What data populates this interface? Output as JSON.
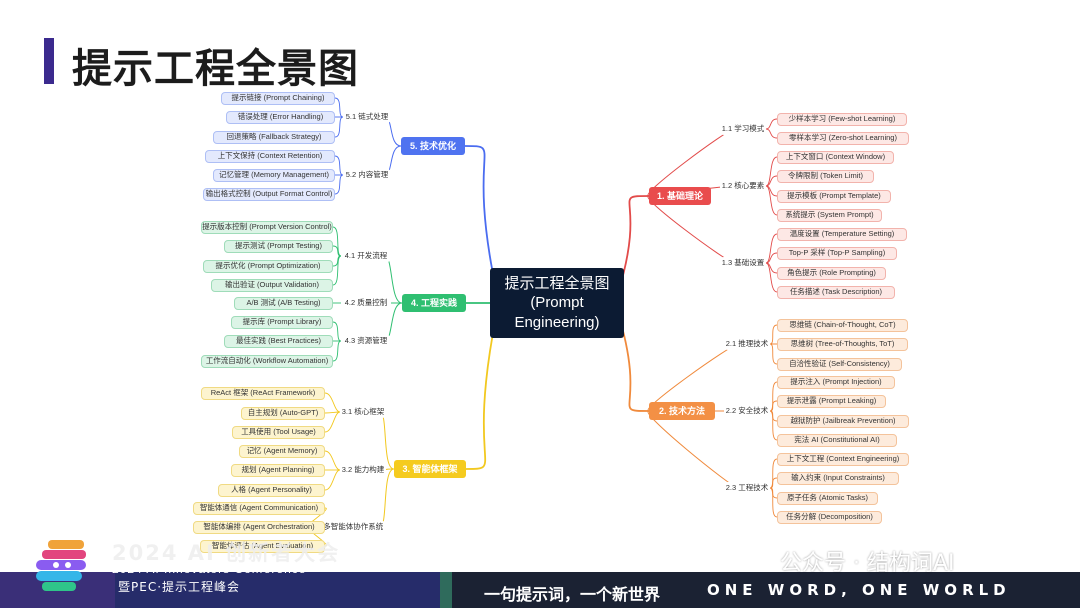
{
  "page": {
    "title": "提示工程全景图"
  },
  "center": {
    "line1": "提示工程全景图",
    "line2": "(Prompt",
    "line3": "Engineering)"
  },
  "branches": [
    {
      "label": "1. 基础理论",
      "color": "#e24b4a",
      "bg": "#e94c4d",
      "subs": [
        {
          "label": "1.1 学习模式",
          "leaves": [
            "少样本学习 (Few-shot Learning)",
            "零样本学习 (Zero-shot Learning)"
          ]
        },
        {
          "label": "1.2 核心要素",
          "leaves": [
            "上下文窗口 (Context Window)",
            "令牌限制 (Token Limit)",
            "提示模板 (Prompt Template)",
            "系统提示 (System Prompt)"
          ]
        },
        {
          "label": "1.3 基础设置",
          "leaves": [
            "温度设置 (Temperature Setting)",
            "Top-P 采样 (Top-P Sampling)",
            "角色提示 (Role Prompting)",
            "任务描述 (Task Description)"
          ]
        }
      ]
    },
    {
      "label": "2. 技术方法",
      "color": "#f08a3c",
      "bg": "#f39045",
      "subs": [
        {
          "label": "2.1 推理技术",
          "leaves": [
            "思维链 (Chain-of-Thought, CoT)",
            "思维树 (Tree-of-Thoughts, ToT)",
            "自洽性验证 (Self-Consistency)"
          ]
        },
        {
          "label": "2.2 安全技术",
          "leaves": [
            "提示注入 (Prompt Injection)",
            "提示泄露 (Prompt Leaking)",
            "越狱防护 (Jailbreak Prevention)",
            "宪法 AI (Constitutional AI)"
          ]
        },
        {
          "label": "2.3 工程技术",
          "leaves": [
            "上下文工程 (Context Engineering)",
            "输入约束 (Input Constraints)",
            "原子任务 (Atomic Tasks)",
            "任务分解 (Decomposition)"
          ]
        }
      ]
    },
    {
      "label": "3. 智能体框架",
      "color": "#f2c81f",
      "bg": "#f5cb1f",
      "subs": [
        {
          "label": "3.1 核心框架",
          "leaves": [
            "ReAct 框架 (ReAct Framework)",
            "自主规划 (Auto-GPT)",
            "工具使用 (Tool Usage)"
          ]
        },
        {
          "label": "3.2 能力构建",
          "leaves": [
            "记忆 (Agent Memory)",
            "规划 (Agent Planning)",
            "人格 (Agent Personality)"
          ]
        },
        {
          "label": "3.3 多智能体协作系统",
          "leaves": [
            "智能体通信 (Agent Communication)",
            "智能体编排 (Agent Orchestration)",
            "智能体评估 (Agent Evaluation)"
          ]
        }
      ]
    },
    {
      "label": "4. 工程实践",
      "color": "#2fbf71",
      "bg": "#2fbf71",
      "subs": [
        {
          "label": "4.1 开发流程",
          "leaves": [
            "提示版本控制 (Prompt Version Control)",
            "提示测试 (Prompt Testing)",
            "提示优化 (Prompt Optimization)",
            "输出验证 (Output Validation)"
          ]
        },
        {
          "label": "4.2 质量控制",
          "leaves": [
            "A/B 测试 (A/B Testing)"
          ]
        },
        {
          "label": "4.3 资源管理",
          "leaves": [
            "提示库 (Prompt Library)",
            "最佳实践 (Best Practices)",
            "工作流自动化 (Workflow Automation)"
          ]
        }
      ]
    },
    {
      "label": "5. 技术优化",
      "color": "#4a6cf0",
      "bg": "#4f73f0",
      "subs": [
        {
          "label": "5.1 链式处理",
          "leaves": [
            "提示链接 (Prompt Chaining)",
            "错误处理 (Error Handling)",
            "回退策略 (Fallback Strategy)"
          ]
        },
        {
          "label": "5.2 内容管理",
          "leaves": [
            "上下文保持 (Context Retention)",
            "记忆管理 (Memory Management)",
            "输出格式控制 (Output Format Control)"
          ]
        }
      ]
    }
  ],
  "footer": {
    "conference_big": "2024 AI 创新者大会",
    "conference_small": "2024 AI Innovators Conference",
    "peak": "暨PEC·提示工程峰会",
    "slogan_cn": "一句提示词，一个新世界",
    "slogan_en": "ONE WORD, ONE WORLD",
    "watermark": "公众号 · 结构词AI",
    "colors": {
      "bar": "#1b2233",
      "left": "#262c6a"
    }
  }
}
